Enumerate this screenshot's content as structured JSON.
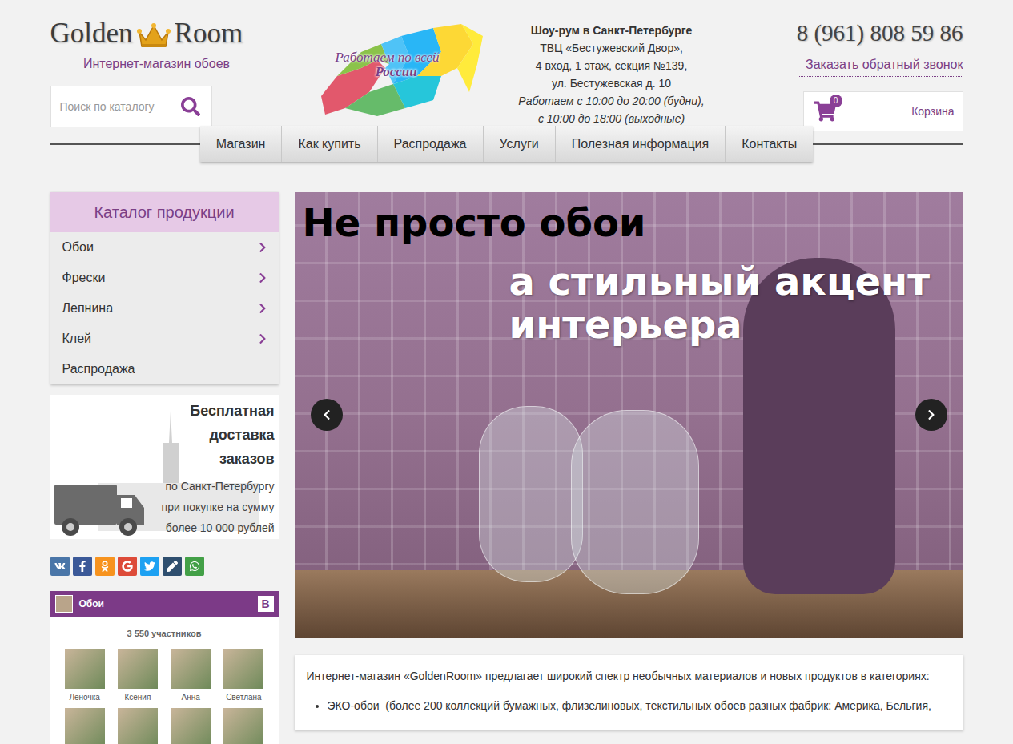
{
  "logo": {
    "left": "Golden",
    "right": "Room",
    "subtitle": "Интернет-магазин обоев"
  },
  "search": {
    "placeholder": "Поиск по каталогу"
  },
  "map_banner": {
    "line1": "Работаем по всей",
    "line2": "России"
  },
  "showroom": {
    "title": "Шоу-рум в Санкт-Петербурге",
    "address": [
      "ТВЦ «Бестужевский Двор»,",
      "4 вход, 1 этаж, секция №139,",
      "ул. Бестужевская д. 10"
    ],
    "hours": [
      "Работаем с 10:00 до 20:00 (будни),",
      "с 10:00 до 18:00 (выходные)"
    ]
  },
  "phone": "8 (961) 808 59 86",
  "callback": "Заказать обратный звонок",
  "cart": {
    "count": "0",
    "label": "Корзина"
  },
  "nav": [
    {
      "label": "Магазин",
      "selected": false
    },
    {
      "label": "Как купить",
      "selected": false
    },
    {
      "label": "Распродажа",
      "selected": false
    },
    {
      "label": "Услуги",
      "selected": false
    },
    {
      "label": "Полезная информация",
      "selected": false
    },
    {
      "label": "Контакты",
      "selected": false
    }
  ],
  "catalog": {
    "title": "Каталог продукции",
    "items": [
      {
        "label": "Обои",
        "has_submenu": true
      },
      {
        "label": "Фрески",
        "has_submenu": true
      },
      {
        "label": "Лепнина",
        "has_submenu": true
      },
      {
        "label": "Клей",
        "has_submenu": true
      },
      {
        "label": "Распродажа",
        "has_submenu": false
      }
    ]
  },
  "delivery": {
    "title": [
      "Бесплатная",
      "доставка",
      "заказов"
    ],
    "body": [
      "по Санкт-Петербургу",
      "при покупке на сумму",
      "более 10 000 рублей"
    ]
  },
  "share": [
    {
      "kind": "vk",
      "color": "#4a76a8"
    },
    {
      "kind": "facebook",
      "color": "#3b5998"
    },
    {
      "kind": "odnoklassniki",
      "color": "#f7931e"
    },
    {
      "kind": "google",
      "color": "#dd4b39"
    },
    {
      "kind": "twitter",
      "color": "#1da1f2"
    },
    {
      "kind": "livejournal",
      "color": "#2f4f6f"
    },
    {
      "kind": "whatsapp",
      "color": "#43a047"
    }
  ],
  "vk_widget": {
    "group": "Обои",
    "badge": "В",
    "members": "3 550 участников",
    "people": [
      {
        "name": "Леночка"
      },
      {
        "name": "Ксения"
      },
      {
        "name": "Анна"
      },
      {
        "name": "Светлана"
      },
      {
        "name": ""
      },
      {
        "name": ""
      },
      {
        "name": ""
      },
      {
        "name": ""
      }
    ]
  },
  "slider": {
    "line1": "Не просто обои",
    "line2": "а стильный акцент",
    "line3": "интерьера"
  },
  "intro": {
    "text": "Интернет-магазин «GoldenRoom» предлагает широкий спектр необычных материалов и новых продуктов в категориях:",
    "bullets": [
      "ЭКО-обои  (более 200 коллекций бумажных, флизелиновых, текстильных обоев разных фабрик: Америка, Бельгия,"
    ]
  }
}
